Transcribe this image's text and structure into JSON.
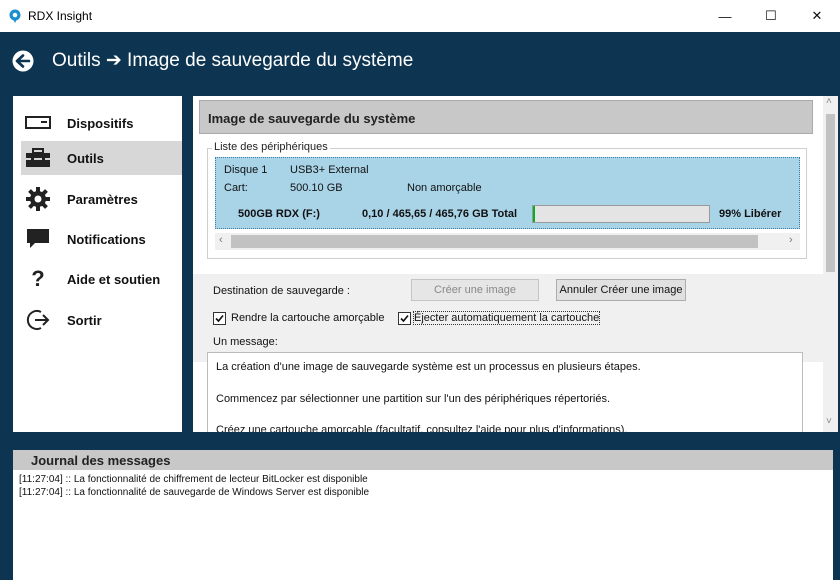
{
  "window": {
    "title": "RDX Insight",
    "minimize": "—",
    "maximize": "☐",
    "close": "✕"
  },
  "header": {
    "title": "Outils ➔ Image de sauvegarde du système"
  },
  "sidebar": {
    "items": [
      {
        "label": "Dispositifs",
        "icon": "drive-icon"
      },
      {
        "label": "Outils",
        "icon": "toolbox-icon",
        "active": true
      },
      {
        "label": "Paramètres",
        "icon": "gear-icon"
      },
      {
        "label": "Notifications",
        "icon": "chat-icon"
      },
      {
        "label": "Aide et soutien",
        "icon": "question-icon"
      },
      {
        "label": "Sortir",
        "icon": "exit-icon"
      }
    ]
  },
  "main": {
    "section_title": "Image de sauvegarde du système",
    "device_list_title": "Liste des périphériques",
    "device": {
      "disk": "Disque 1",
      "interface": "USB3+ External",
      "cart_label": "Cart:",
      "cart_size": "500.10 GB",
      "boot_status": "Non amorçable",
      "volume": "500GB RDX (F:)",
      "usage": "0,10 / 465,65 / 465,76 GB Total",
      "free_percent": 99,
      "free_label": "99% Libérer"
    },
    "destination_label": "Destination de sauvegarde :",
    "create_button": "Créer une image",
    "cancel_button": "Annuler Créer une image",
    "checkbox_bootable": {
      "label": "Rendre la cartouche amorçable",
      "checked": true
    },
    "checkbox_eject": {
      "label": "Éjecter automatiquement la cartouche",
      "checked": true
    },
    "message_label": "Un message:",
    "messages": [
      "La création d'une image de sauvegarde système est un processus en plusieurs étapes.",
      "Commencez par sélectionner une partition sur l'un des périphériques répertoriés.",
      "Créez une cartouche amorçable (facultatif, consultez l'aide pour plus d'informations)."
    ]
  },
  "log": {
    "title": "Journal des messages",
    "lines": [
      "[11:27:04] :: La fonctionnalité de chiffrement de lecteur BitLocker est disponible",
      "[11:27:04] :: La fonctionnalité de sauvegarde de Windows Server est disponible"
    ]
  },
  "colors": {
    "header_bg": "#0d3450",
    "device_highlight": "#a9d4e8",
    "progress_green": "#06b025"
  }
}
